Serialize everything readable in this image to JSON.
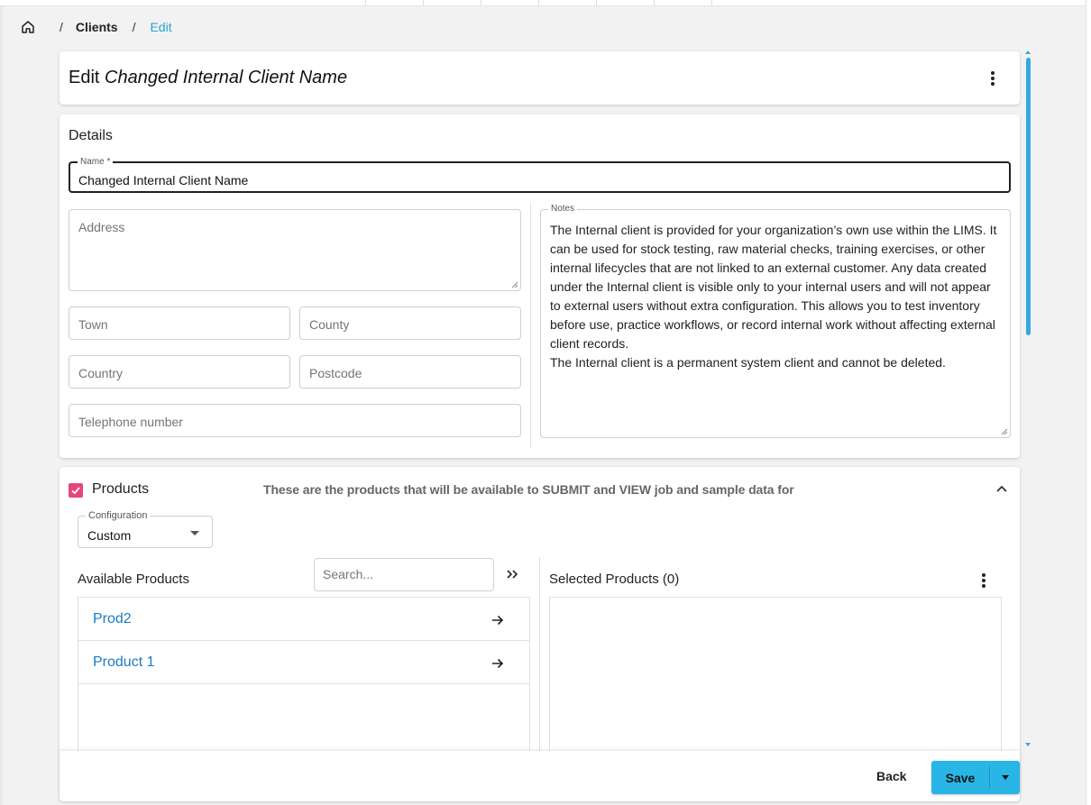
{
  "breadcrumb": {
    "home_icon": "home-icon",
    "separator": "/",
    "items": [
      "Clients",
      "Edit"
    ]
  },
  "header": {
    "title_prefix": "Edit",
    "title_name": "Changed Internal Client Name",
    "menu_icon": "more-vert-icon"
  },
  "details": {
    "section_title": "Details",
    "name_label": "Name *",
    "name_value": "Changed Internal Client Name",
    "address_placeholder": "Address",
    "town_placeholder": "Town",
    "county_placeholder": "County",
    "country_placeholder": "Country",
    "postcode_placeholder": "Postcode",
    "telephone_placeholder": "Telephone number",
    "notes_label": "Notes",
    "notes_value": "The Internal client is provided for your organization’s own use within the LIMS. It can be used for stock testing, raw material checks, training exercises, or other internal lifecycles that are not linked to an external customer. Any data created under the Internal client is visible only to your internal users and will not appear to external users without extra configuration. This allows you to test inventory before use, practice workflows, or record internal work without affecting external client records.\nThe Internal client is a permanent system client and cannot be deleted."
  },
  "products": {
    "checked": true,
    "title": "Products",
    "description": "These are the products that will be available to SUBMIT and VIEW job and sample data for",
    "configuration_label": "Configuration",
    "configuration_value": "Custom",
    "available_title": "Available Products",
    "search_placeholder": "Search...",
    "selected_title": "Selected Products (0)",
    "available_items": [
      {
        "name": "Prod2"
      },
      {
        "name": "Product 1"
      }
    ]
  },
  "footer": {
    "back_label": "Back",
    "save_label": "Save"
  },
  "colors": {
    "accent": "#29b5e6",
    "link": "#1a7bc4",
    "checkbox": "#e8457a",
    "breadcrumb_active": "#29a3d6"
  }
}
